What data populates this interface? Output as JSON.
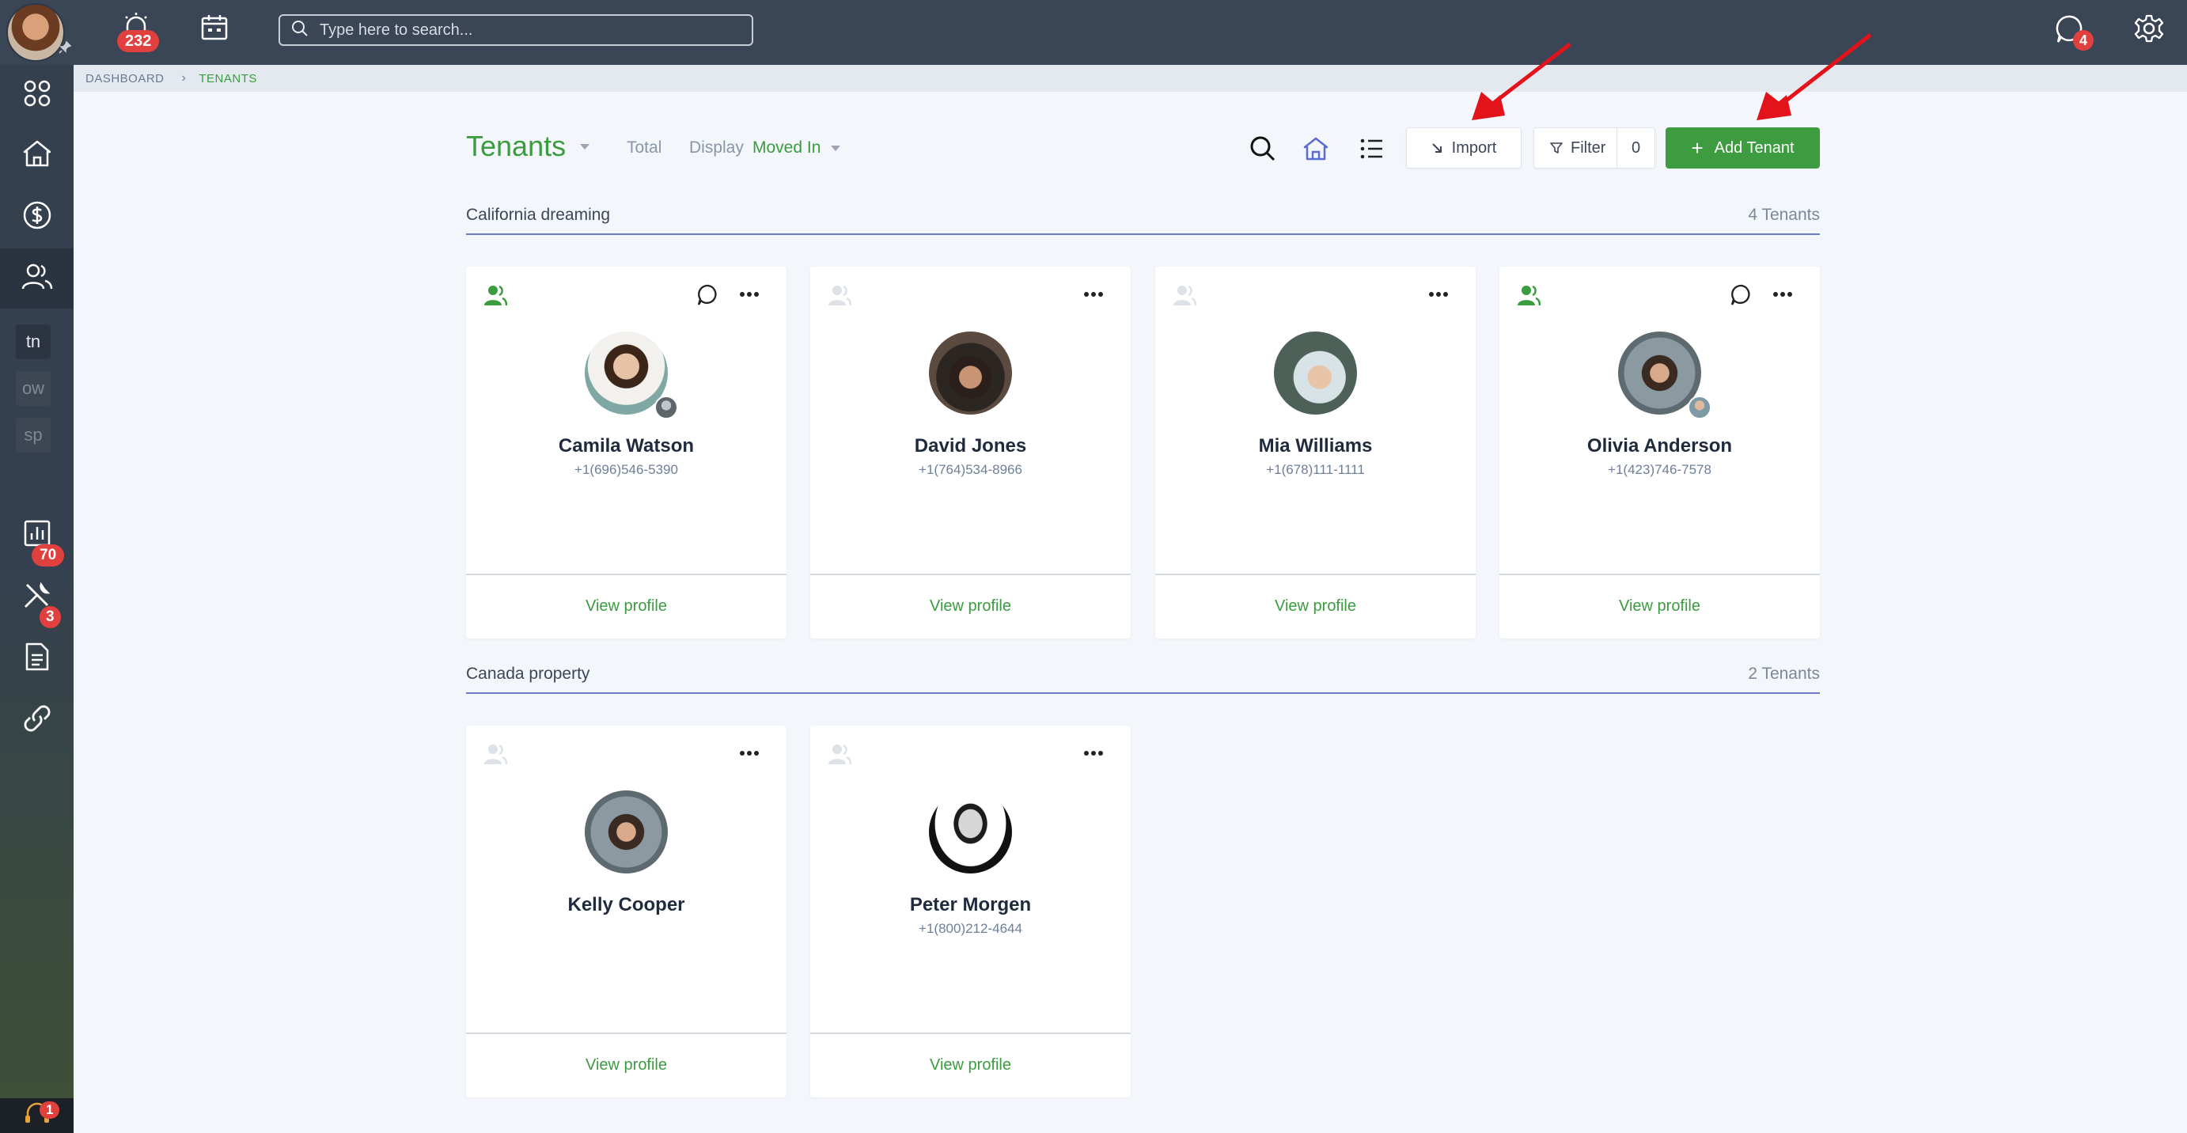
{
  "topbar": {
    "notifications_count": "232",
    "search_placeholder": "Type here to search...",
    "messages_count": "4"
  },
  "sidebar": {
    "items": [
      {
        "icon": "apps-grid-icon"
      },
      {
        "icon": "home-icon"
      },
      {
        "icon": "dollar-circle-icon"
      },
      {
        "icon": "people-icon"
      },
      {
        "label": "tn"
      },
      {
        "label": "ow"
      },
      {
        "label": "sp"
      },
      {
        "icon": "bar-chart-icon"
      },
      {
        "icon": "tools-icon",
        "badge": "70"
      },
      {
        "icon": "document-icon",
        "badge": "3"
      },
      {
        "icon": "link-icon"
      }
    ],
    "support_badge": "1"
  },
  "breadcrumb": {
    "root": "DASHBOARD",
    "current": "TENANTS"
  },
  "header": {
    "title": "Tenants",
    "total_label": "Total",
    "display_label": "Display",
    "display_value": "Moved In",
    "import_label": "Import",
    "filter_label": "Filter",
    "filter_count": "0",
    "add_label": "Add Tenant"
  },
  "sections": [
    {
      "title": "California dreaming",
      "count": "4 Tenants",
      "tenants": [
        {
          "name": "Camila Watson",
          "phone": "+1(696)546-5390",
          "link": "View profile"
        },
        {
          "name": "David Jones",
          "phone": "+1(764)534-8966",
          "link": "View profile"
        },
        {
          "name": "Mia Williams",
          "phone": "+1(678)111-1111",
          "link": "View profile"
        },
        {
          "name": "Olivia Anderson",
          "phone": "+1(423)746-7578",
          "link": "View profile"
        }
      ]
    },
    {
      "title": "Canada property",
      "count": "2 Tenants",
      "tenants": [
        {
          "name": "Kelly Cooper",
          "phone": "",
          "link": "View profile"
        },
        {
          "name": "Peter Morgen",
          "phone": "+1(800)212-4644",
          "link": "View profile"
        }
      ]
    }
  ],
  "colors": {
    "accent_green": "#3a9c3f",
    "topbar_bg": "#3a4555",
    "badge_red": "#e0403e",
    "section_line": "#6d7bc9",
    "annotation_arrow": "#e3131b"
  }
}
